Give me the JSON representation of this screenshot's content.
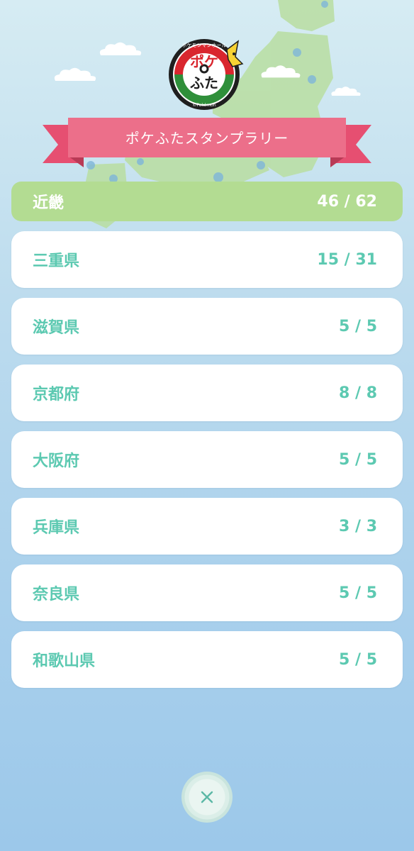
{
  "header": {
    "logo_text_top": "ポケモンマンホール",
    "logo_text_main1": "ポケ",
    "logo_text_main2": "ふた",
    "logo_text_bottom": "©Pokémon",
    "title": "ポケふたスタンプラリー"
  },
  "region": {
    "name": "近畿",
    "progress": "46 / 62"
  },
  "prefectures": [
    {
      "name": "三重県",
      "progress": "15 / 31"
    },
    {
      "name": "滋賀県",
      "progress": "5 / 5"
    },
    {
      "name": "京都府",
      "progress": "8 / 8"
    },
    {
      "name": "大阪府",
      "progress": "5 / 5"
    },
    {
      "name": "兵庫県",
      "progress": "3 / 3"
    },
    {
      "name": "奈良県",
      "progress": "5 / 5"
    },
    {
      "name": "和歌山県",
      "progress": "5 / 5"
    }
  ],
  "icons": {
    "close": "close-icon"
  },
  "colors": {
    "region_bar": "#b3dc92",
    "row_text": "#5cc9b1",
    "banner": "#ec6f8a",
    "banner_tail": "#e64f71"
  }
}
